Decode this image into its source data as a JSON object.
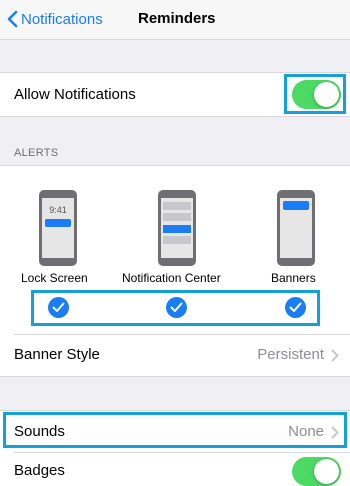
{
  "nav": {
    "back_label": "Notifications",
    "title": "Reminders"
  },
  "allow_notifications": {
    "label": "Allow Notifications",
    "enabled": true
  },
  "alerts": {
    "header": "ALERTS",
    "phone_time": "9:41",
    "options": [
      {
        "label": "Lock Screen",
        "checked": true
      },
      {
        "label": "Notification Center",
        "checked": true
      },
      {
        "label": "Banners",
        "checked": true
      }
    ]
  },
  "banner_style": {
    "label": "Banner Style",
    "value": "Persistent"
  },
  "sounds": {
    "label": "Sounds",
    "value": "None"
  },
  "badges": {
    "label": "Badges",
    "enabled": true
  },
  "colors": {
    "accent": "#1a7df5",
    "toggle_on": "#4cd964",
    "highlight": "#16a0d8"
  },
  "icons": [
    "chevron-left-icon",
    "chevron-right-icon",
    "checkmark-icon"
  ]
}
